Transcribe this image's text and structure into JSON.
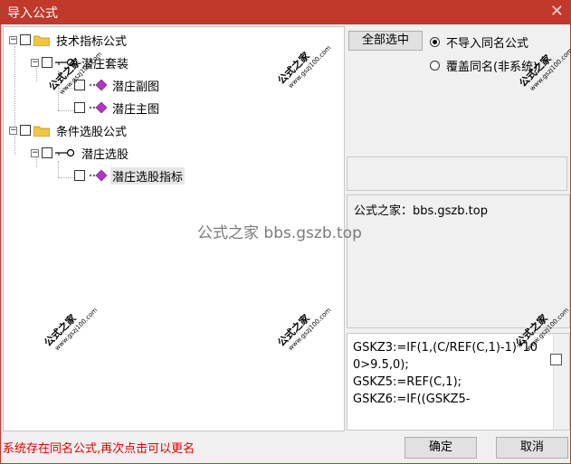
{
  "window": {
    "title": "导入公式",
    "close_glyph": "✕"
  },
  "tree": [
    {
      "label": "技术指标公式",
      "icon": "folder-icon"
    },
    {
      "label": "潜庄套装",
      "icon": "key-icon"
    },
    {
      "label": "潜庄副图",
      "icon": "diamond-icon"
    },
    {
      "label": "潜庄主图",
      "icon": "diamond-icon"
    },
    {
      "label": "条件选股公式",
      "icon": "folder-icon"
    },
    {
      "label": "潜庄选股",
      "icon": "key-icon"
    },
    {
      "label": "潜庄选股指标",
      "icon": "diamond-icon"
    }
  ],
  "buttons": {
    "select_all": "全部选中",
    "ok": "确定",
    "cancel": "取消"
  },
  "radios": {
    "no_import": "不导入同名公式",
    "overwrite": "覆盖同名(非系统)",
    "selected": "no_import"
  },
  "description": "公式之家：bbs.gszb.top",
  "code_preview": "GSKZ3:=IF(1,(C/REF(C,1)-1)*100>9.5,0);\nGSKZ5:=REF(C,1);\nGSKZ6:=IF((GSKZ5-",
  "status_message": "系统存在同名公式,再次点击可以更名",
  "watermark": {
    "title": "公式之家",
    "url": "www.gszj100.com",
    "center_text": "公式之家 bbs.gszb.top"
  }
}
